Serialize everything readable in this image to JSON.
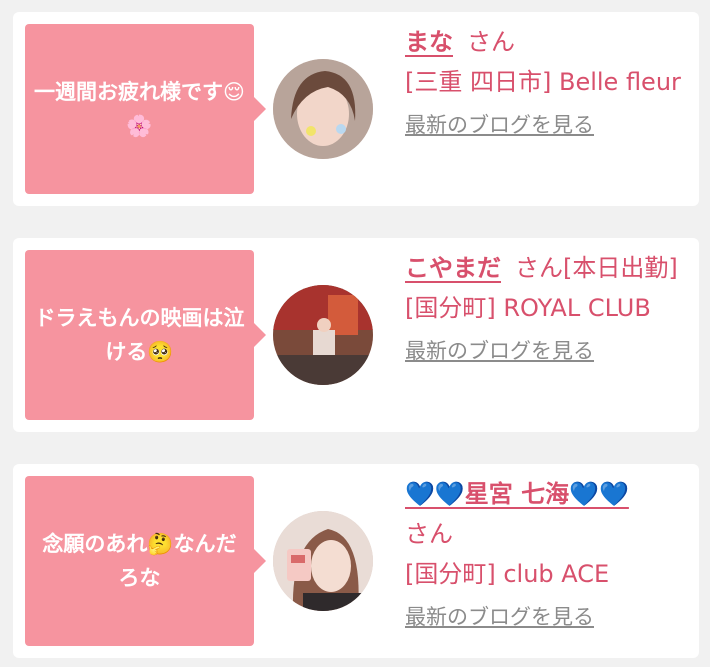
{
  "cards": [
    {
      "bubble_text": "一週間お疲れ様です😌🌸",
      "name": "まな",
      "san": "さん",
      "shop": "[三重 四日市] Belle fleur",
      "blog_link": "最新のブログを見る"
    },
    {
      "bubble_text": "ドラえもんの映画は泣ける🥺",
      "name": "こやまだ",
      "san": "さん[本日出勤]",
      "shop": "[国分町] ROYAL CLUB",
      "blog_link": "最新のブログを見る"
    },
    {
      "bubble_text": "念願のあれ🤔なんだろな",
      "name": "💙💙星宮 七海💙💙",
      "san": "さん",
      "shop": "[国分町] club ACE",
      "blog_link": "最新のブログを見る"
    }
  ],
  "colors": {
    "bubble": "#f6949f",
    "name": "#d8506c",
    "link": "#8b8b8b",
    "card": "#ffffff",
    "background": "#f1f1f1"
  }
}
